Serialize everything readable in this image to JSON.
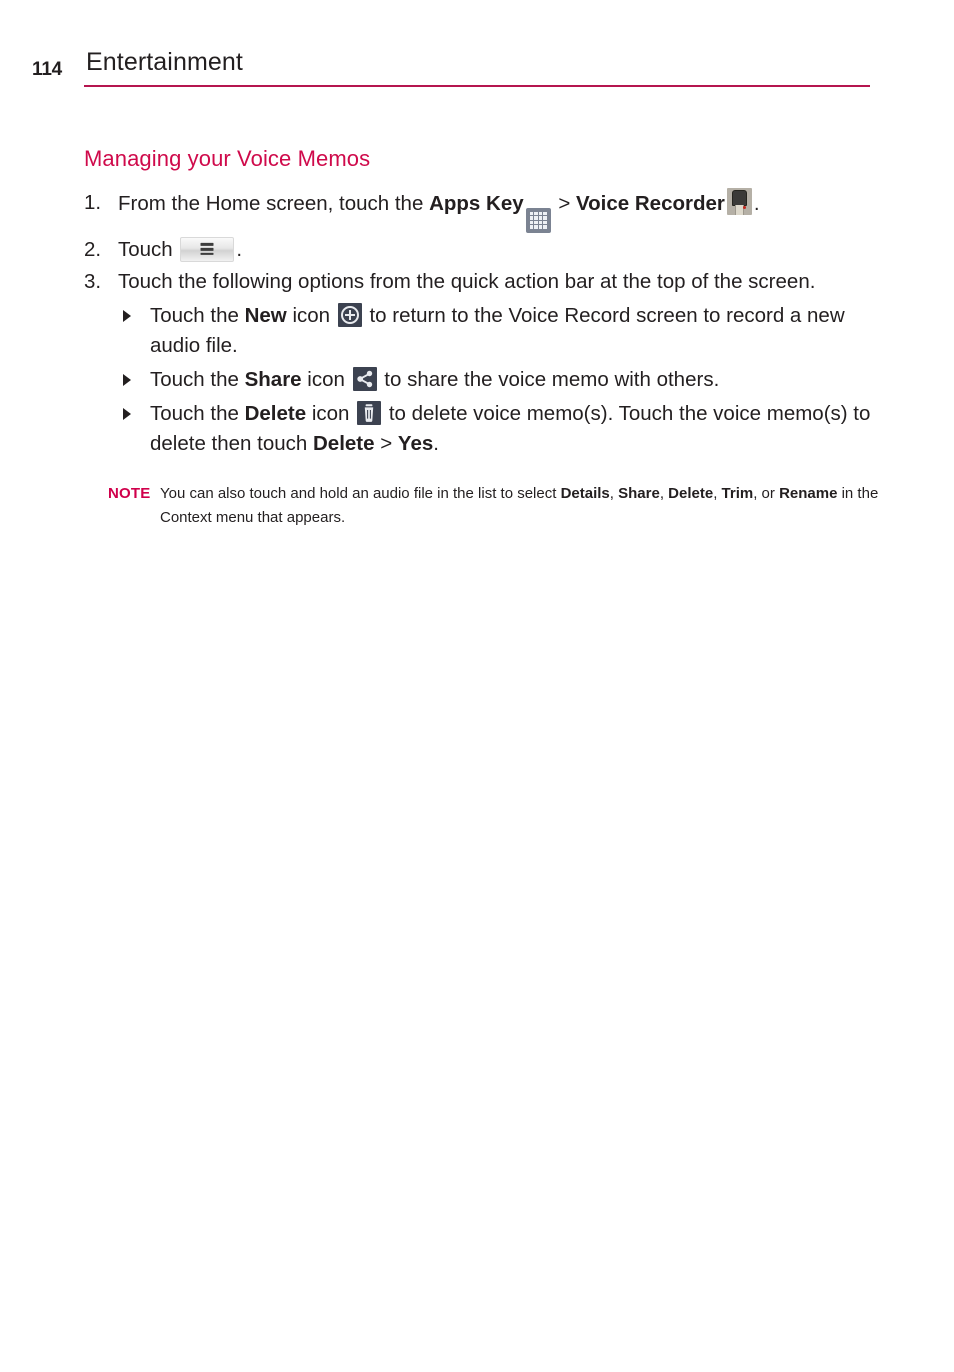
{
  "header": {
    "page_number": "114",
    "title": "Entertainment",
    "rule_color": "#b5154f"
  },
  "section": {
    "heading": "Managing your Voice Memos",
    "heading_color": "#cf0a4b"
  },
  "steps": [
    {
      "number": "1.",
      "parts": {
        "t1": "From the Home screen, touch the ",
        "bold1": "Apps Key",
        "icon1": "apps-key-icon",
        "t2": " > ",
        "bold2": "Voice Recorder",
        "icon2": "voice-recorder-icon",
        "t3": "."
      }
    },
    {
      "number": "2.",
      "parts": {
        "t1": "Touch ",
        "icon1": "menu-key-icon",
        "t2": "."
      }
    },
    {
      "number": "3.",
      "parts": {
        "t1": "Touch the following options from the quick action bar at the top of the screen."
      }
    }
  ],
  "bullets": [
    {
      "t1": "Touch the ",
      "bold1": "New",
      "t2": " icon ",
      "icon": "new-icon",
      "t3": " to return to the Voice Record screen to record a new audio file."
    },
    {
      "t1": "Touch the ",
      "bold1": "Share",
      "t2": " icon ",
      "icon": "share-icon",
      "t3": " to share the voice memo with others."
    },
    {
      "t1": "Touch the ",
      "bold1": "Delete",
      "t2": " icon ",
      "icon": "delete-icon",
      "t3": " to delete voice memo(s). Touch the voice memo(s) to delete then touch ",
      "bold2": "Delete",
      "t4": " > ",
      "bold3": "Yes",
      "t5": "."
    }
  ],
  "note": {
    "label": "NOTE",
    "label_color": "#d0004b",
    "t1": "You can also touch and hold an audio file in the list to select ",
    "bold1": "Details",
    "t2": ", ",
    "bold2": "Share",
    "t3": ", ",
    "bold3": "Delete",
    "t4": ", ",
    "bold4": "Trim",
    "t5": ", or ",
    "bold5": "Rename",
    "t6": " in the Context menu that appears."
  }
}
